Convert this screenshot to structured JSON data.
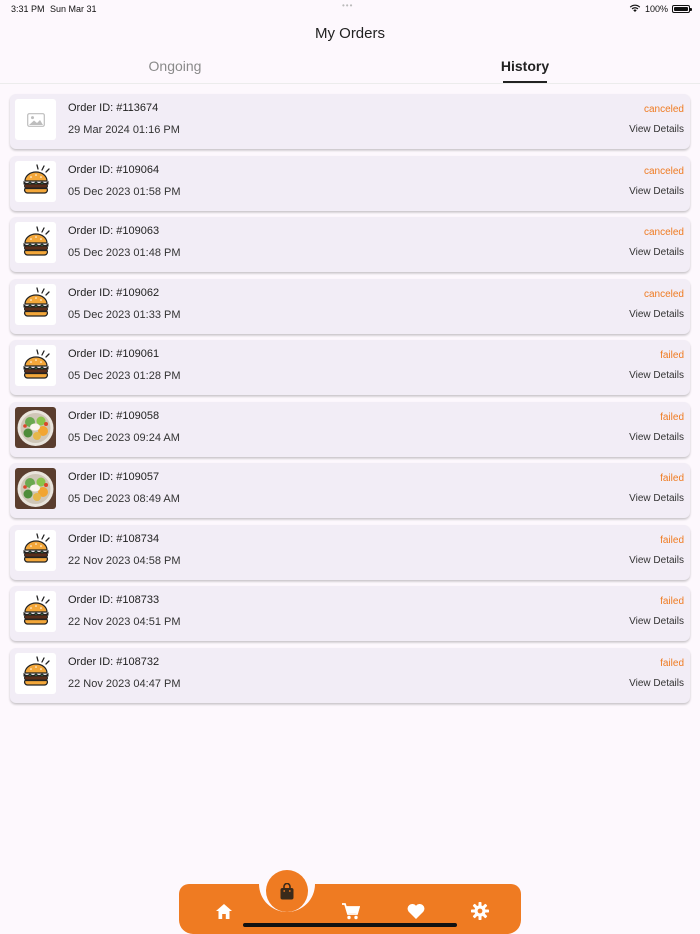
{
  "status_bar": {
    "time": "3:31 PM",
    "date": "Sun Mar 31",
    "dots": "•••",
    "battery": "100%",
    "battery_level": 1.0
  },
  "page": {
    "title": "My Orders"
  },
  "tabs": [
    {
      "label": "Ongoing",
      "active": false
    },
    {
      "label": "History",
      "active": true
    }
  ],
  "order_id_label": "Order ID:",
  "view_details_label": "View Details",
  "orders": [
    {
      "id": "#113674",
      "datetime": "29 Mar 2024  01:16 PM",
      "status": "canceled",
      "thumb": "placeholder-image-icon"
    },
    {
      "id": "#109064",
      "datetime": "05 Dec 2023  01:58 PM",
      "status": "canceled",
      "thumb": "burger-icon"
    },
    {
      "id": "#109063",
      "datetime": "05 Dec 2023  01:48 PM",
      "status": "canceled",
      "thumb": "burger-icon"
    },
    {
      "id": "#109062",
      "datetime": "05 Dec 2023  01:33 PM",
      "status": "canceled",
      "thumb": "burger-icon"
    },
    {
      "id": "#109061",
      "datetime": "05 Dec 2023  01:28 PM",
      "status": "failed",
      "thumb": "burger-icon"
    },
    {
      "id": "#109058",
      "datetime": "05 Dec 2023  09:24 AM",
      "status": "failed",
      "thumb": "salad-bowl-photo"
    },
    {
      "id": "#109057",
      "datetime": "05 Dec 2023  08:49 AM",
      "status": "failed",
      "thumb": "salad-bowl-photo"
    },
    {
      "id": "#108734",
      "datetime": "22 Nov 2023  04:58 PM",
      "status": "failed",
      "thumb": "burger-icon"
    },
    {
      "id": "#108733",
      "datetime": "22 Nov 2023  04:51 PM",
      "status": "failed",
      "thumb": "burger-icon"
    },
    {
      "id": "#108732",
      "datetime": "22 Nov 2023  04:47 PM",
      "status": "failed",
      "thumb": "burger-icon"
    }
  ],
  "bottom_nav": {
    "items": [
      "home-icon",
      "shopping-bag-icon",
      "cart-icon",
      "heart-icon",
      "gear-icon"
    ],
    "active": "shopping-bag-icon"
  },
  "colors": {
    "accent": "#ef7b22",
    "card_bg": "#f2edf6",
    "page_bg": "#fdf8fd"
  }
}
